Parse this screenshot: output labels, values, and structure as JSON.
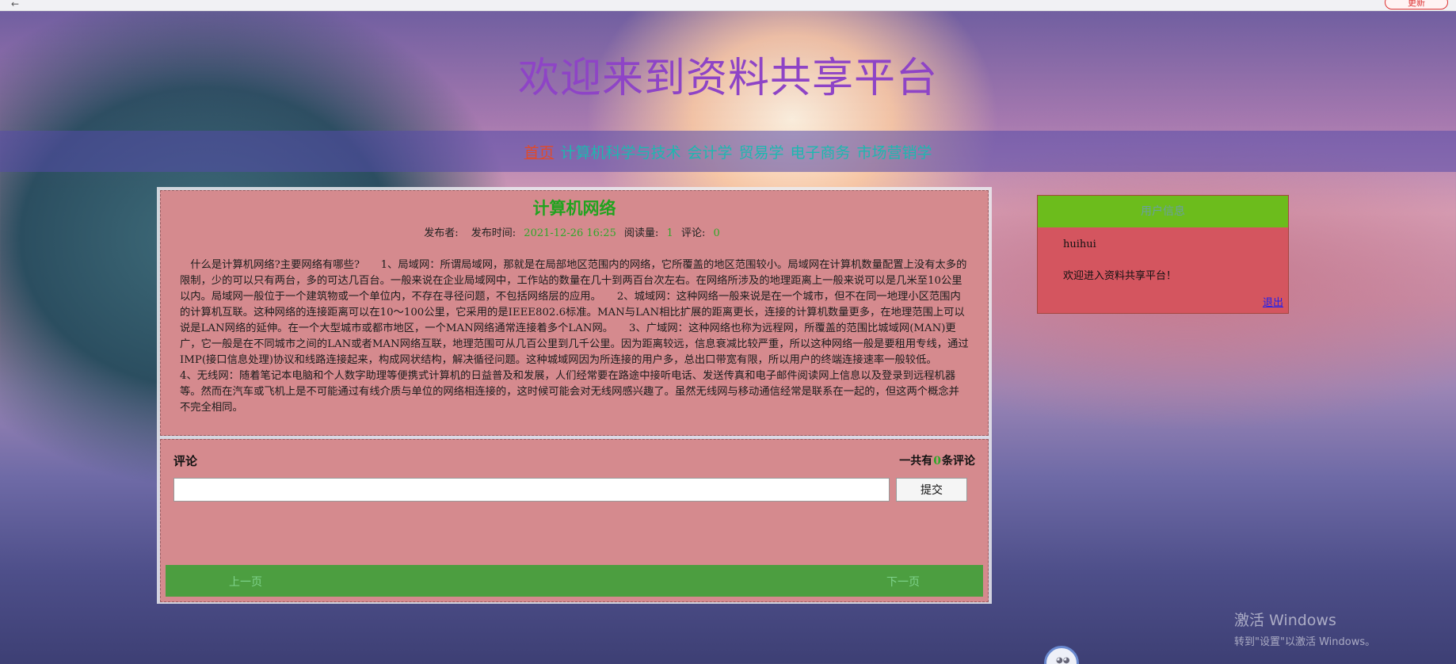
{
  "browser": {
    "update_label": "更新"
  },
  "site": {
    "title": "欢迎来到资料共享平台"
  },
  "nav": {
    "items": [
      {
        "label": "首页"
      },
      {
        "label": "计算机科学与技术"
      },
      {
        "label": "会计学"
      },
      {
        "label": "贸易学"
      },
      {
        "label": "电子商务"
      },
      {
        "label": "市场营销学"
      }
    ]
  },
  "article": {
    "title": "计算机网络",
    "meta": {
      "publisher_label": "发布者:",
      "publisher_value": "",
      "time_label": "发布时间:",
      "time_value": "2021-12-26 16:25",
      "views_label": "阅读量:",
      "views_value": "1",
      "comments_label": "评论:",
      "comments_value": "0"
    },
    "body": "什么是计算机网络?主要网络有哪些?　　1、局域网：所谓局域网，那就是在局部地区范围内的网络，它所覆盖的地区范围较小。局域网在计算机数量配置上没有太多的限制，少的可以只有两台，多的可达几百台。一般来说在企业局域网中，工作站的数量在几十到两百台次左右。在网络所涉及的地理距离上一般来说可以是几米至10公里以内。局域网一般位于一个建筑物或一个单位内，不存在寻径问题，不包括网络层的应用。　　2、城域网：这种网络一般来说是在一个城市，但不在同一地理小区范围内的计算机互联。这种网络的连接距离可以在10～100公里，它采用的是IEEE802.6标准。MAN与LAN相比扩展的距离更长，连接的计算机数量更多，在地理范围上可以说是LAN网络的延伸。在一个大型城市或都市地区，一个MAN网络通常连接着多个LAN网。　　3、广域网：这种网络也称为远程网，所覆盖的范围比城域网(MAN)更广，它一般是在不同城市之间的LAN或者MAN网络互联，地理范围可从几百公里到几千公里。因为距离较远，信息衰减比较严重，所以这种网络一般是要租用专线，通过IMP(接口信息处理)协议和线路连接起来，构成网状结构，解决循径问题。这种城域网因为所连接的用户多，总出口带宽有限，所以用户的终端连接速率一般较低。　　4、无线网：随着笔记本电脑和个人数字助理等便携式计算机的日益普及和发展，人们经常要在路途中接听电话、发送传真和电子邮件阅读网上信息以及登录到远程机器等。然而在汽车或飞机上是不可能通过有线介质与单位的网络相连接的，这时候可能会对无线网感兴趣了。虽然无线网与移动通信经常是联系在一起的，但这两个概念并不完全相同。"
  },
  "comments": {
    "heading": "评论",
    "count_prefix": "一共有",
    "count_value": "0",
    "count_suffix": "条评论",
    "input_value": "",
    "input_placeholder": "",
    "submit_label": "提交"
  },
  "pager": {
    "prev_label": "上一页",
    "next_label": "下一页"
  },
  "user_panel": {
    "header": "用户信息",
    "username": "huihui",
    "welcome": "欢迎进入资料共享平台！",
    "logout_label": "退出"
  },
  "watermark": {
    "line1": "激活 Windows",
    "line2": "转到\"设置\"以激活 Windows。"
  },
  "colors": {
    "title": "#8e44c6",
    "nav_link": "#1cb8b0",
    "nav_active": "#e04a2b",
    "panel_pink": "#d58a8e",
    "accent_green": "#2ea82a",
    "pager_green": "#4c9e40",
    "user_header_green": "#6cbc1c",
    "user_panel_red": "#d4555f"
  }
}
